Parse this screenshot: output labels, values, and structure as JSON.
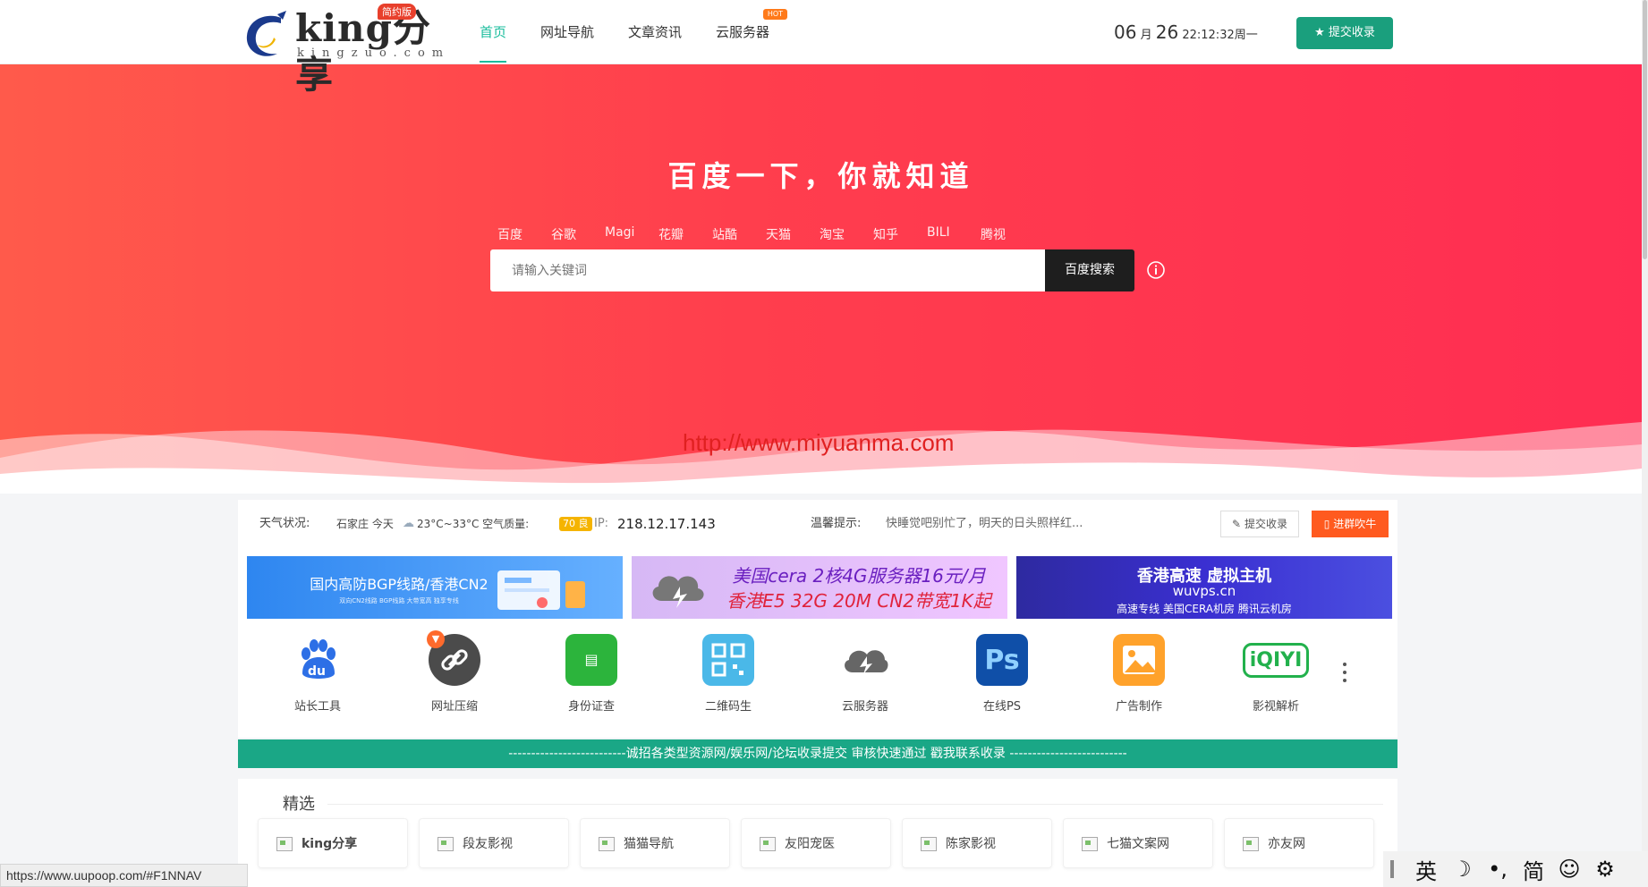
{
  "header": {
    "logo_text": "king分享",
    "logo_sub": "kingzuo.com",
    "logo_badge": "简约版",
    "nav": [
      {
        "label": "首页",
        "active": true
      },
      {
        "label": "网址导航"
      },
      {
        "label": "文章资讯"
      },
      {
        "label": "云服务器",
        "badge": "HOT"
      }
    ],
    "clock": {
      "month": "06",
      "month_unit": "月",
      "day": "26",
      "time": "22:12:32",
      "weekday": "周一"
    },
    "submit_label": "提交收录"
  },
  "hero": {
    "title": "百度一下，你就知道",
    "engines": [
      "百度",
      "谷歌",
      "Magi",
      "花瓣",
      "站酷",
      "天猫",
      "淘宝",
      "知乎",
      "BILI",
      "腾视"
    ],
    "search_placeholder": "请输入关键词",
    "search_button": "百度搜索",
    "watermark": "http://www.miyuanma.com"
  },
  "info_bar": {
    "weather_label": "天气状况:",
    "weather_text": "石家庄 今天",
    "temp": "23°C~33°C 空气质量:",
    "aqi": "70 良",
    "ip_label": "IP:",
    "ip": "218.12.17.143",
    "tip_label": "温馨提示:",
    "tip": "快睡觉吧别忙了，明天的日头照样红...",
    "submit_button": "提交收录",
    "group_button": "进群吹牛"
  },
  "banners": [
    {
      "line1": "国内高防BGP线路/香港CN2",
      "line2": "双向CN2线路  BGP线路  大带宽高  独享专线"
    },
    {
      "line1": "美国cera 2核4G服务器16元/月",
      "line2": "香港E5 32G 20M CN2带宽1K起"
    },
    {
      "line1": "香港高速 虚拟主机",
      "line2": "wuvps.cn",
      "line3": "高速专线 美国CERA机房 腾讯云机房"
    }
  ],
  "quick_links": [
    {
      "label": "站长工具",
      "icon": "baidu-paw-icon"
    },
    {
      "label": "网址压缩",
      "icon": "link-icon"
    },
    {
      "label": "身份证查",
      "icon": "id-card-icon"
    },
    {
      "label": "二维码生",
      "icon": "qrcode-icon"
    },
    {
      "label": "云服务器",
      "icon": "cloud-icon"
    },
    {
      "label": "在线PS",
      "icon": "photoshop-icon"
    },
    {
      "label": "广告制作",
      "icon": "image-icon"
    },
    {
      "label": "影视解析",
      "icon": "iqiyi-icon"
    }
  ],
  "notice": "--------------------------诚招各类型资源网/娱乐网/论坛收录提交 审核快速通过 戳我联系收录 --------------------------",
  "section": {
    "title": "精选",
    "sites": [
      "king分享",
      "段友影视",
      "猫猫导航",
      "友阳宠医",
      "陈家影视",
      "七猫文案网",
      "亦友网"
    ]
  },
  "status_url": "https://www.uupoop.com/#F1NNAV",
  "ime": [
    "英",
    "☽",
    "•,",
    "简",
    "☺",
    "⚙"
  ],
  "colors": {
    "accent": "#1abc9c",
    "hero_start": "#ff5a4b",
    "hero_end": "#ff2d52",
    "notice": "#1aa786"
  }
}
